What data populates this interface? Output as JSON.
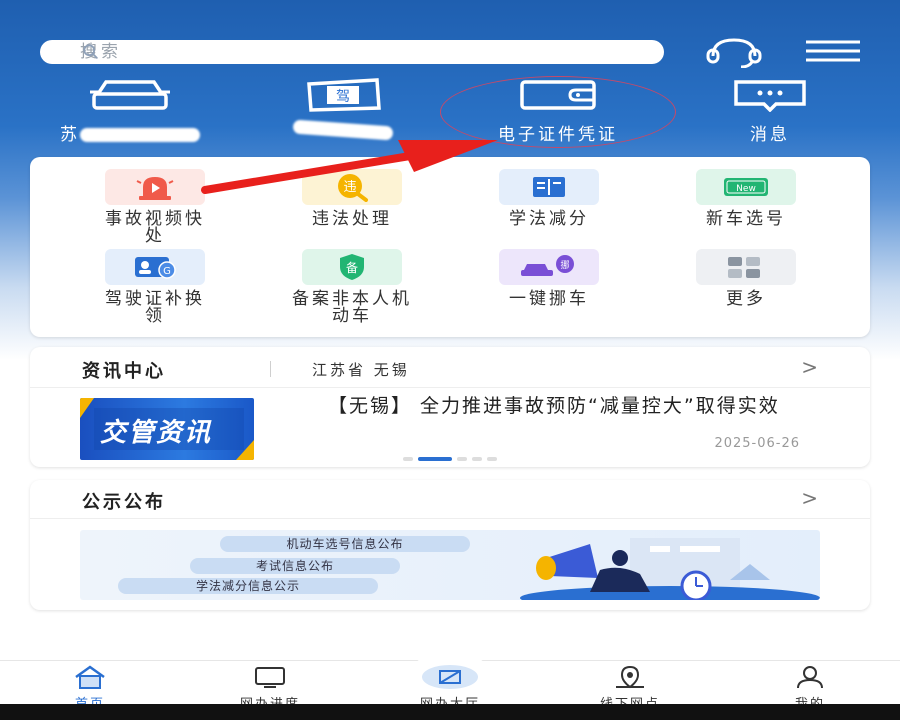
{
  "search": {
    "placeholder": "搜索"
  },
  "quick": [
    {
      "label": "苏",
      "icon": "car-icon"
    },
    {
      "label": "",
      "icon": "license-icon",
      "badge": "驾"
    },
    {
      "label": "电子证件凭证",
      "icon": "wallet-icon"
    },
    {
      "label": "消息",
      "icon": "message-icon"
    }
  ],
  "services": [
    {
      "label": "事故视频快处",
      "icon": "alarm-light-icon",
      "color": "#f05a4a"
    },
    {
      "label": "违法处理",
      "icon": "violation-icon",
      "color": "#f5b400",
      "badge": "违"
    },
    {
      "label": "学法减分",
      "icon": "book-icon",
      "color": "#2a6fd1"
    },
    {
      "label": "新车选号",
      "icon": "new-plate-icon",
      "color": "#22b573",
      "badge": "New"
    },
    {
      "label": "驾驶证补换领",
      "icon": "license-card-icon",
      "color": "#2a6fd1"
    },
    {
      "label": "备案非本人机动车",
      "icon": "shield-icon",
      "color": "#22b573",
      "badge": "备"
    },
    {
      "label": "一键挪车",
      "icon": "move-car-icon",
      "color": "#7a4fd6",
      "badge": "挪"
    },
    {
      "label": "更多",
      "icon": "more-icon",
      "color": "#8a94a0"
    }
  ],
  "news": {
    "title": "资讯中心",
    "region": "江苏省 无锡",
    "thumb_text": "交管资讯",
    "headline": "【无锡】 全力推进事故预防“减量控大”取得实效",
    "date": "2025-06-26"
  },
  "notice": {
    "title": "公示公布",
    "items": [
      "机动车选号信息公布",
      "考试信息公布",
      "学法减分信息公示"
    ]
  },
  "nav": [
    {
      "label": "首页",
      "icon": "home-icon",
      "active": true
    },
    {
      "label": "网办进度",
      "icon": "monitor-icon"
    },
    {
      "label": "网办大厅",
      "icon": "hall-icon"
    },
    {
      "label": "线下网点",
      "icon": "location-icon"
    },
    {
      "label": "我的",
      "icon": "user-icon"
    }
  ],
  "colors": {
    "brand": "#2a6fd1",
    "annotation": "#e8201c"
  }
}
